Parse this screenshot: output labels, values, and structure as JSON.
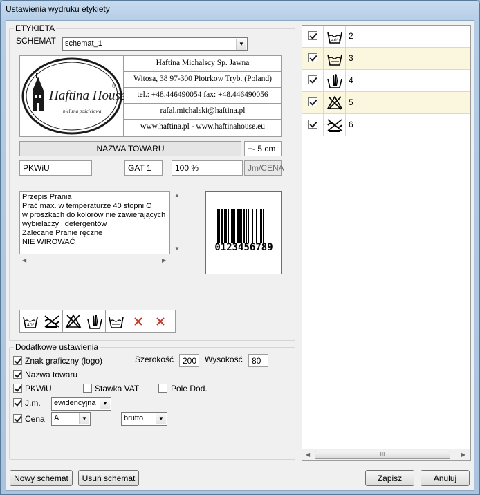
{
  "window": {
    "title": "Ustawienia wydruku etykiety"
  },
  "etykieta": {
    "legend": "ETYKIETA",
    "schemat_label": "SCHEMAT",
    "schemat_value": "schemat_1",
    "logo": {
      "brand": "Haftina House",
      "tagline": "bielizna pościelowa"
    },
    "company": [
      "Haftina Michalscy Sp. Jawna",
      "Witosa, 38 97-300 Piotrkow Tryb. (Poland)",
      "tel.: +48.446490054 fax: +48.446490056",
      "rafal.michalski@haftina.pl",
      "www.haftina.pl - www.haftinahouse.eu"
    ],
    "nazwa_towaru": "NAZWA TOWARU",
    "tolerance": "+- 5 cm",
    "pkwiu": "PKWiU",
    "gat": "GAT 1",
    "percent": "100 %",
    "jm_cena": "Jm/CENA",
    "washing_text": [
      "Przepis Prania",
      "Prać max. w temperaturze 40 stopni C",
      "w proszkach do kolorów nie zawierających",
      "wybielaczy i detergentów",
      "Zalecane Pranie ręczne",
      "NIE WIROWAĆ"
    ],
    "barcode_digits": "0123456789",
    "icon_strip": [
      "wash-40-icon",
      "no-wring-icon",
      "no-bleach-icon",
      "hand-wash-icon",
      "wash-tub-icon",
      "remove-icon",
      "remove-icon"
    ]
  },
  "dodatkowe": {
    "legend": "Dodatkowe ustawienia",
    "logo_label": "Znak graficzny (logo)",
    "logo_checked": true,
    "szerokosc_label": "Szerokość",
    "szerokosc_value": "200",
    "wysokosc_label": "Wysokość",
    "wysokosc_value": "80",
    "nazwa_label": "Nazwa towaru",
    "nazwa_checked": true,
    "pkwiu_label": "PKWiU",
    "pkwiu_checked": true,
    "vat_label": "Stawka VAT",
    "vat_checked": false,
    "pole_label": "Pole Dod.",
    "pole_checked": false,
    "jm_label": "J.m.",
    "jm_checked": true,
    "jm_value": "ewidencyjna",
    "cena_label": "Cena",
    "cena_checked": true,
    "cena_value": "A",
    "cena_type": "brutto"
  },
  "symbols": [
    {
      "num": "2",
      "icon": "wash-40-icon",
      "checked": true
    },
    {
      "num": "3",
      "icon": "wash-tub-icon",
      "checked": true
    },
    {
      "num": "4",
      "icon": "hand-wash-icon",
      "checked": true
    },
    {
      "num": "5",
      "icon": "no-bleach-icon",
      "checked": true
    },
    {
      "num": "6",
      "icon": "no-wring-icon",
      "checked": true
    }
  ],
  "scroll_thumb_glyph": "III",
  "buttons": {
    "new": "Nowy schemat",
    "delete": "Usuń schemat",
    "save": "Zapisz",
    "cancel": "Anuluj"
  }
}
